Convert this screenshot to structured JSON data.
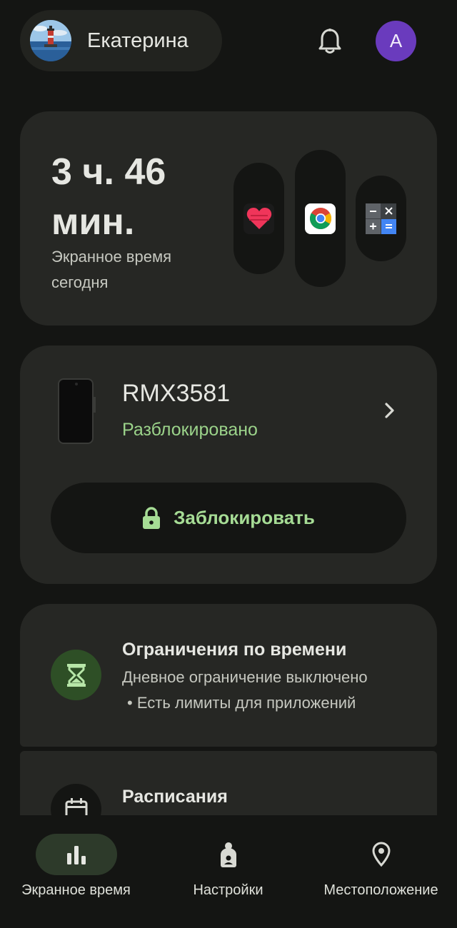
{
  "header": {
    "user_name": "Екатерина",
    "avatar_icon": "lighthouse-photo",
    "notifications_icon": "bell-icon",
    "account_initial": "A",
    "account_color": "#6a3bbd"
  },
  "screen_time": {
    "value": "3 ч. 46 мин.",
    "label": "Экранное время сегодня",
    "apps": [
      {
        "name": "heart-app-icon"
      },
      {
        "name": "chrome-icon"
      },
      {
        "name": "calculator-icon"
      }
    ]
  },
  "device": {
    "name": "RMX3581",
    "status": "Разблокировано",
    "status_color": "#9bd38a",
    "lock_button_label": "Заблокировать"
  },
  "limits": {
    "title": "Ограничения по времени",
    "description": "Дневное ограничение выключено",
    "sub": "• Есть лимиты для приложений"
  },
  "schedules": {
    "title": "Расписания"
  },
  "nav": {
    "items": [
      {
        "label": "Экранное время",
        "icon": "bar-chart-icon",
        "active": true
      },
      {
        "label": "Настройки",
        "icon": "child-icon",
        "active": false
      },
      {
        "label": "Местоположение",
        "icon": "location-pin-icon",
        "active": false
      }
    ]
  }
}
